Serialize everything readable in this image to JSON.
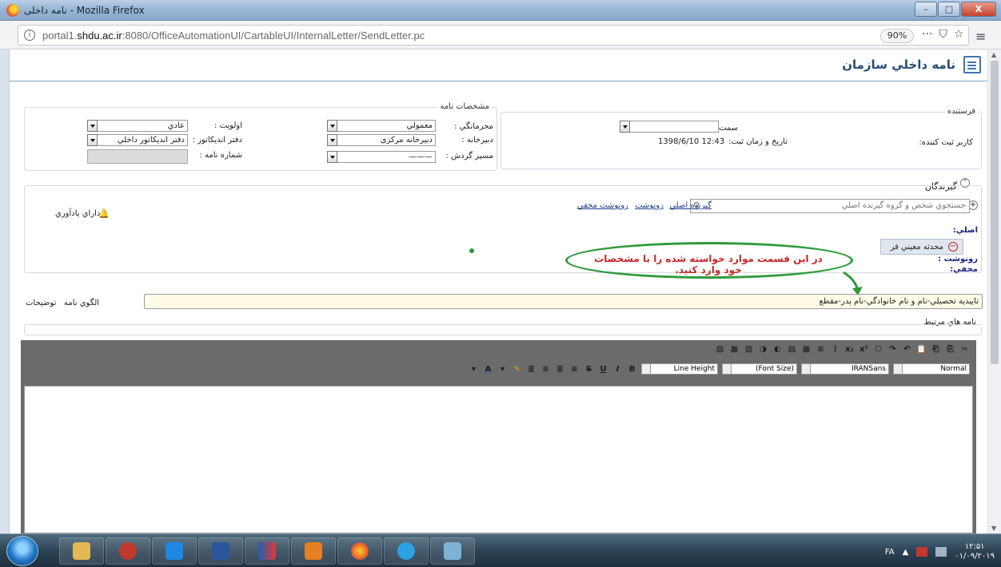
{
  "window": {
    "title": "نامه داخلی - Mozilla Firefox",
    "minimize": "–",
    "maximize": "□",
    "close": "X"
  },
  "browser": {
    "url_prefix": "portal1.",
    "url_domain": "shdu.ac.ir",
    "url_rest": ":8080/OfficeAutomationUI/CartableUI/InternalLetter/SendLetter.pc",
    "zoom": "90%",
    "more_icon": "···",
    "pocket_icon": "⛉",
    "star_icon": "☆",
    "menu_icon": "≡"
  },
  "page": {
    "title": "نامه داخلي سازمان"
  },
  "sender": {
    "legend": "فرستنده",
    "direction_label": "سمت :",
    "direction_value": "",
    "register_date_label": "تاريخ و زمان ثبت:",
    "register_date_value": "1398/6/10  12:43",
    "register_user_label": "کاربر ثبت کننده:"
  },
  "letter_specs": {
    "legend": "مشخصات نامه",
    "confidentiality_label": "محرمانگي :",
    "confidentiality_value": "معمولي",
    "priority_label": "اولويت :",
    "priority_value": "عادي",
    "secretariat_label": "دبيرخانه :",
    "secretariat_value": "دبيرخانه مرکزی",
    "indicator_office_label": "دفتر انديکاتور :",
    "indicator_office_value": "دفتر انديکاتور داخلي",
    "routing_label": "مسير گردش :",
    "routing_value": "———",
    "letter_number_label": "شماره نامه :",
    "letter_number_value": ""
  },
  "recipients": {
    "legend": "گيرندگان",
    "search_placeholder": "جستجوي شخص و گروه گيرنده اصلي",
    "link_main": "گيرنده اصلي",
    "link_cc": "رونوشت",
    "link_bcc": "رونوشت مخفي",
    "reminder": "داراي يادآوري",
    "main_label": "اصلي:",
    "main_recipient": "محدثه معيني فر",
    "cc_label": "رونوشت :",
    "bcc_label": "مخفي:",
    "annotation": "در این قسمت موارد خواسته شده را با مشخصات خود وارد کنید."
  },
  "subject": {
    "value": "تاييديه تحصيلي-نام و نام خانوادگي-نام پدر-مقطع",
    "link_template": "الگوي نامه",
    "link_description": "توضيحات"
  },
  "related": {
    "legend": "نامه هاي مرتبط"
  },
  "editor": {
    "format_value": "Normal",
    "font_value": "IRANSans",
    "font_size_value": "(Font Size)",
    "line_height_value": "Line Height",
    "toolbar_top": [
      "✂",
      "⎘",
      "⎗",
      "📋",
      "↶",
      "↷",
      "⎔",
      "x²",
      "x₂",
      "⋮",
      "≡",
      "▦",
      "▤",
      "◐",
      "◑",
      "▨",
      "▦",
      "▧"
    ],
    "toolbar_bottom": [
      "B",
      "I",
      "U",
      "S",
      "≡",
      "≣",
      "≡",
      "≣",
      "✎",
      "▾",
      "A",
      "▾"
    ]
  },
  "taskbar": {
    "lang": "FA",
    "time": "۱۲:۵۱",
    "date": "۰۱/۰۹/۲۰۱۹",
    "tray_arrow": "▲"
  },
  "colors": {
    "accent": "#274c77",
    "annotation_red": "#c62828",
    "annotation_green": "#2e9b3a",
    "subject_bg": "#fffbe6",
    "recipient_chip": "#dfe6ee"
  }
}
